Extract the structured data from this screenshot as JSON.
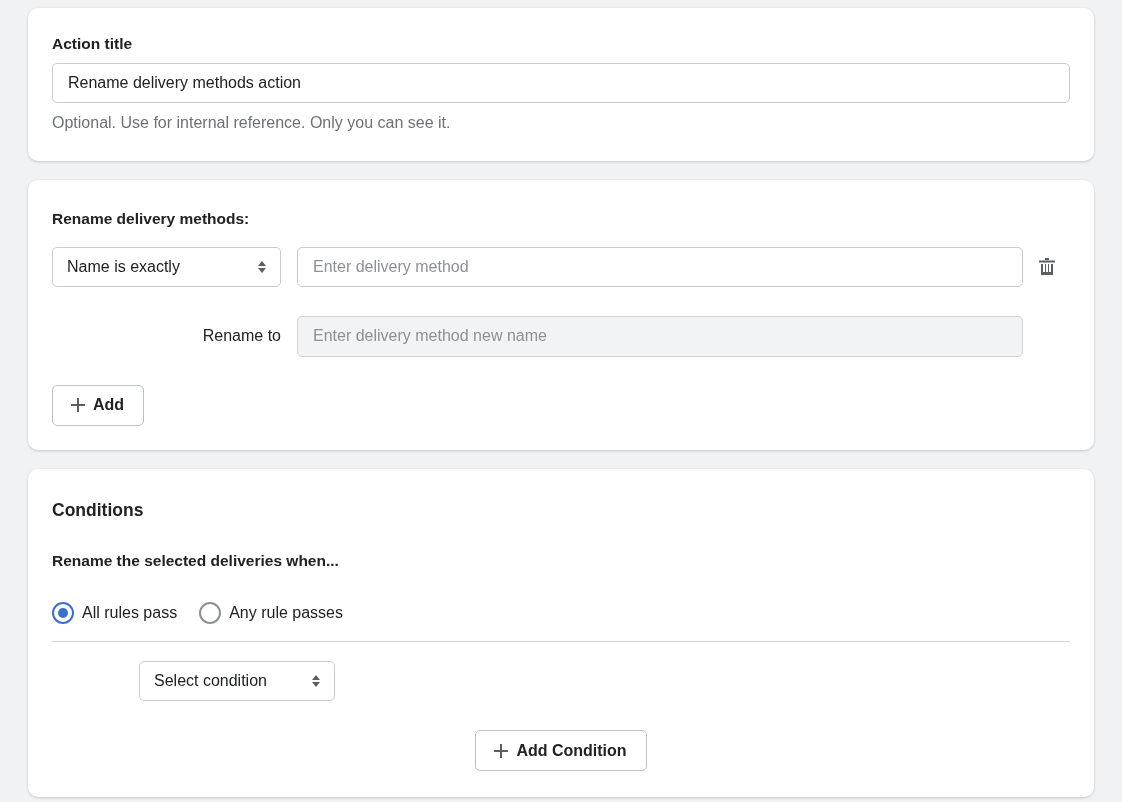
{
  "action_title": {
    "label": "Action title",
    "value": "Rename delivery methods action",
    "help": "Optional. Use for internal reference. Only you can see it."
  },
  "rename": {
    "heading": "Rename delivery methods:",
    "rules": [
      {
        "match": "Name is exactly",
        "placeholder": "Enter delivery method",
        "rename_label": "Rename to",
        "rename_placeholder": "Enter delivery method new name",
        "rename_disabled": true
      }
    ],
    "add_button": "Add"
  },
  "conditions": {
    "title": "Conditions",
    "subtitle": "Rename the selected deliveries when...",
    "options": [
      {
        "label": "All rules pass",
        "selected": true
      },
      {
        "label": "Any rule passes",
        "selected": false
      }
    ],
    "select": "Select condition",
    "add_button": "Add Condition"
  }
}
